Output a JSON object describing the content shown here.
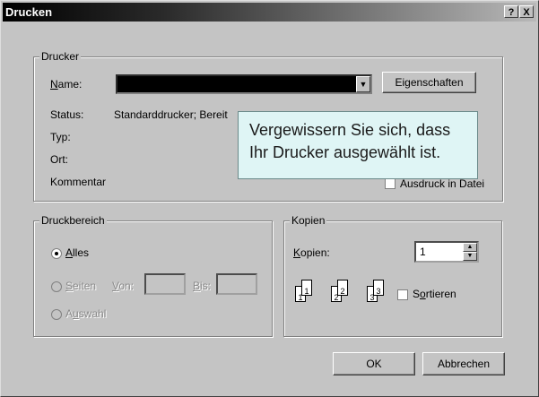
{
  "window": {
    "title": "Drucken",
    "help_btn": "?",
    "close_btn": "X"
  },
  "printer_group": {
    "legend": "Drucker",
    "name_label": "Name:",
    "name_value": "",
    "properties_btn": "Eigenschaften",
    "status_label": "Status:",
    "status_value": "Standarddrucker; Bereit",
    "type_label": "Typ:",
    "location_label": "Ort:",
    "comment_label": "Kommentar",
    "print_to_file": "Ausdruck in Datei"
  },
  "tooltip": {
    "line1": "Vergewissern Sie sich, dass",
    "line2": "Ihr Drucker ausgewählt ist."
  },
  "range_group": {
    "legend": "Druckbereich",
    "all": "Alles",
    "pages": "Seiten",
    "from_label": "Von:",
    "to_label": "Bis:",
    "selection": "Auswahl",
    "selected": "all"
  },
  "copies_group": {
    "legend": "Kopien",
    "copies_label": "Kopien:",
    "copies_value": "1",
    "collate": "Sortieren",
    "collate_checked": false
  },
  "buttons": {
    "ok": "OK",
    "cancel": "Abbrechen"
  }
}
